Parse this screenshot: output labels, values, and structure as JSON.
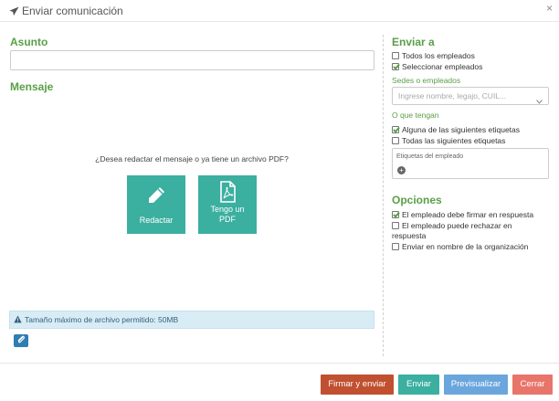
{
  "header": {
    "title": "Enviar comunicación",
    "close_glyph": "×"
  },
  "left": {
    "subject_label": "Asunto",
    "subject_value": "",
    "message_label": "Mensaje",
    "prompt": "¿Desea redactar el mensaje o ya tiene un archivo PDF?",
    "compose_label": "Redactar",
    "pdf_label_line1": "Tengo un",
    "pdf_label_line2": "PDF",
    "max_size_notice": "Tamaño máximo de archivo permitido: 50MB"
  },
  "send_to": {
    "heading": "Enviar a",
    "all_employees": {
      "label": "Todos los empleados",
      "checked": false
    },
    "select_employees": {
      "label": "Seleccionar empleados",
      "checked": true
    },
    "sites_label": "Sedes o empleados",
    "sites_placeholder": "Ingrese nombre, legajo, CUIL...",
    "filter_label": "O que tengan",
    "any_tags": {
      "label": "Alguna de las siguientes etiquetas",
      "checked": true
    },
    "all_tags": {
      "label": "Todas las siguientes etiquetas",
      "checked": false
    },
    "tags_placeholder": "Etiquetas del empleado"
  },
  "options": {
    "heading": "Opciones",
    "must_sign": {
      "label": "El empleado debe firmar en respuesta",
      "checked": true
    },
    "can_reject_line1": "El empleado puede rechazar en",
    "can_reject_line2": "respuesta",
    "can_reject_checked": false,
    "send_as_org": {
      "label": "Enviar en nombre de la organización",
      "checked": false
    }
  },
  "footer": {
    "sign_send": "Firmar y enviar",
    "send": "Enviar",
    "preview": "Previsualizar",
    "close": "Cerrar"
  },
  "colors": {
    "accent_green": "#5a9f47",
    "teal": "#3bafa0",
    "btn_red": "#c0502f",
    "btn_teal": "#3bafa0",
    "btn_blue": "#6aa6dc",
    "btn_salmon": "#e8756a",
    "info_bg": "#d8ecf5",
    "attach_blue": "#2e7db3"
  },
  "icons": [
    "paper-plane-icon",
    "close-icon",
    "pencil-icon",
    "pdf-file-icon",
    "warning-icon",
    "paperclip-icon",
    "chevron-down-icon",
    "plus-icon"
  ]
}
